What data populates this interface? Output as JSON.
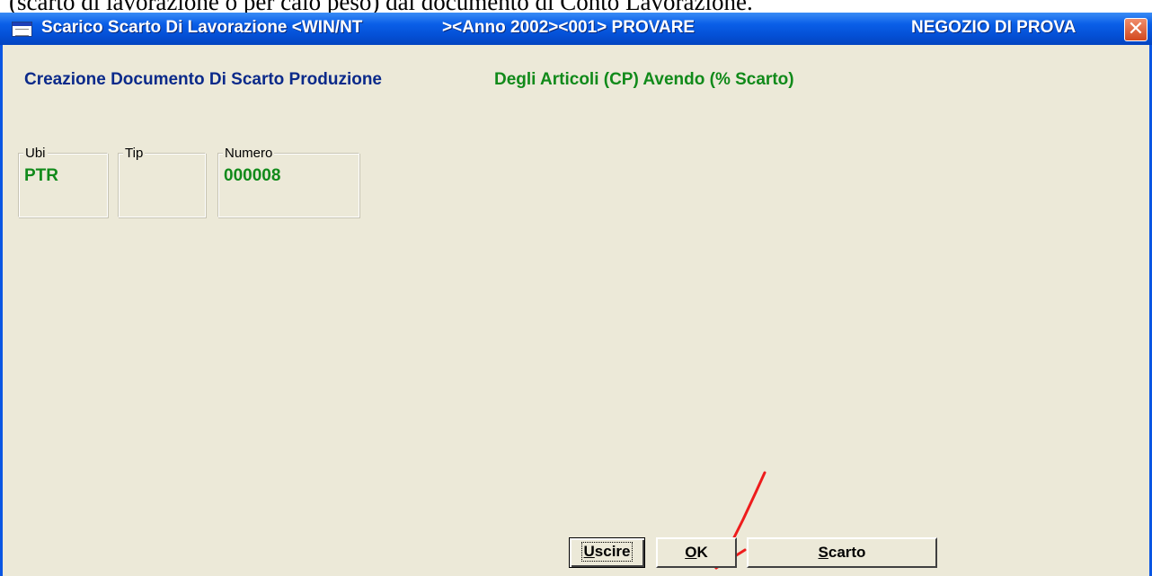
{
  "caption": {
    "text": "(scarto di lavorazione o per calo peso) dal documento di Conto Lavorazione."
  },
  "window": {
    "title": "Scarico Scarto Di Lavorazione <WIN/NT",
    "title_year": "><Anno 2002><001> PROVARE",
    "title_store": "NEGOZIO DI PROVA",
    "close_glyph": "✕",
    "icon": "app-window-icon"
  },
  "header": {
    "main": "Creazione Documento Di Scarto Produzione",
    "sub": "Degli Articoli (CP) Avendo (% Scarto)"
  },
  "fields": [
    {
      "label": "Ubi",
      "value": "PTR"
    },
    {
      "label": "Tip",
      "value": ""
    },
    {
      "label": "Numero",
      "value": "000008"
    }
  ],
  "buttons": {
    "exit": {
      "hotkey": "U",
      "rest": "scire"
    },
    "ok": {
      "hotkey": "O",
      "rest": "K"
    },
    "discard": {
      "hotkey": "S",
      "rest": "carto"
    }
  },
  "colors": {
    "title_blue": "#0b2a8a",
    "value_green": "#118a1a",
    "annotation_red": "#ee1c1c",
    "window_face": "#ece9d8"
  }
}
